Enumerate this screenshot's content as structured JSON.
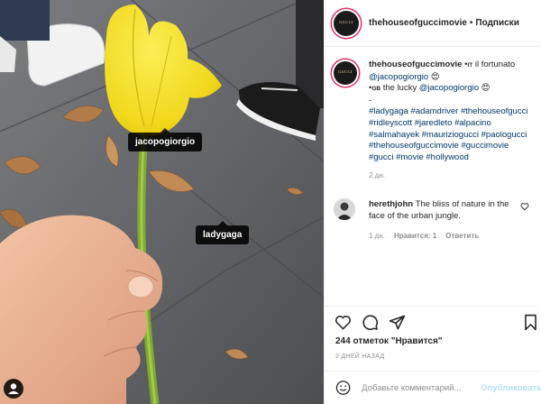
{
  "photo": {
    "tags": [
      "jacopogiorgio",
      "ladygaga"
    ],
    "icons": {
      "people_tag": "person-icon"
    }
  },
  "header": {
    "username": "thehouseofguccimovie",
    "separator": "•",
    "follow_label": "Подписки",
    "avatar_text": "GUCCI"
  },
  "caption": {
    "username": "thehouseofguccimovie",
    "segments": [
      {
        "text": " •",
        "kind": "plain"
      },
      {
        "text": "IT",
        "kind": "small"
      },
      {
        "text": " il fortunato ",
        "kind": "plain"
      },
      {
        "text": "@jacopogiorgio",
        "kind": "mention"
      },
      {
        "text": " 😍",
        "kind": "plain"
      }
    ],
    "line2": [
      {
        "text": "•",
        "kind": "plain"
      },
      {
        "text": "GB",
        "kind": "small"
      },
      {
        "text": " the lucky ",
        "kind": "plain"
      },
      {
        "text": "@jacopogiorgio",
        "kind": "mention"
      },
      {
        "text": " 😍",
        "kind": "plain"
      }
    ],
    "dash": "-",
    "hashtags": [
      "#ladygaga",
      "#adamdriver",
      "#thehouseofgucci",
      "#ridleyscott",
      "#jaredleto",
      "#alpacino",
      "#salmahayek",
      "#mauriziogucci",
      "#paologucci",
      "#thehouseofguccimovie",
      "#guccimovie",
      "#gucci",
      "#movie",
      "#hollywood"
    ],
    "age": "2 дн."
  },
  "comment": {
    "username": "herethjohn",
    "text": "The bliss of nature in the face of the urban jungle.",
    "age": "1 дн.",
    "likes": "Нравится: 1",
    "reply": "Ответить"
  },
  "actions": {
    "icons": [
      "heart-icon",
      "comment-icon",
      "share-icon",
      "bookmark-icon"
    ],
    "likes": "244 отметок \"Нравится\"",
    "date": "2 ДНЕЙ НАЗАД"
  },
  "add_comment": {
    "placeholder": "Добавьте комментарий...",
    "publish": "Опубликовать",
    "emoji_icon": "emoji-icon"
  },
  "colors": {
    "link": "#00376b",
    "muted": "#8e8e8e",
    "publish_disabled": "#b2dffc",
    "story_ring": "#e1306c",
    "flower": "#f5e12a"
  }
}
